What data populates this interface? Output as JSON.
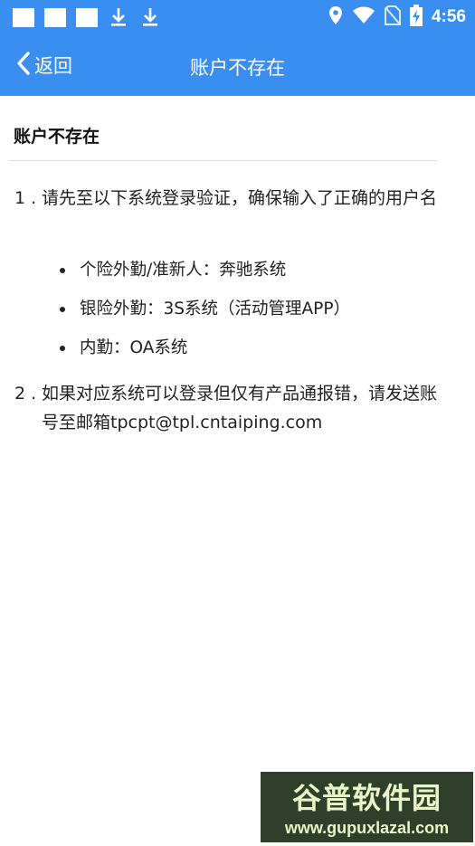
{
  "status_bar": {
    "time": "4:56",
    "left_icons": [
      "notification-square-icon",
      "notification-square-icon",
      "notification-square-icon",
      "download-icon",
      "download-icon"
    ],
    "right_icons": [
      "location-icon",
      "wifi-icon",
      "no-sim-icon",
      "battery-charging-icon"
    ]
  },
  "app_bar": {
    "back_label": "返回",
    "title": "账户不存在"
  },
  "content": {
    "heading": "账户不存在",
    "items": [
      {
        "number": "1 .",
        "text": "请先至以下系统登录验证，确保输入了正确的用户名",
        "bullets": [
          "个险外勤/准新人：奔驰系统",
          "银险外勤：3S系统（活动管理APP）",
          "内勤：OA系统"
        ]
      },
      {
        "number": "2 .",
        "text": "如果对应系统可以登录但仅有产品通报错，请发送账号至邮箱tpcpt@tpl.cntaiping.com"
      }
    ]
  },
  "watermark": {
    "logo_text": "谷普软件园",
    "url": "www.gupuxlazal.com"
  },
  "colors": {
    "accent": "#3a8ef0",
    "text": "#222222",
    "divider": "#dcdcdc"
  }
}
